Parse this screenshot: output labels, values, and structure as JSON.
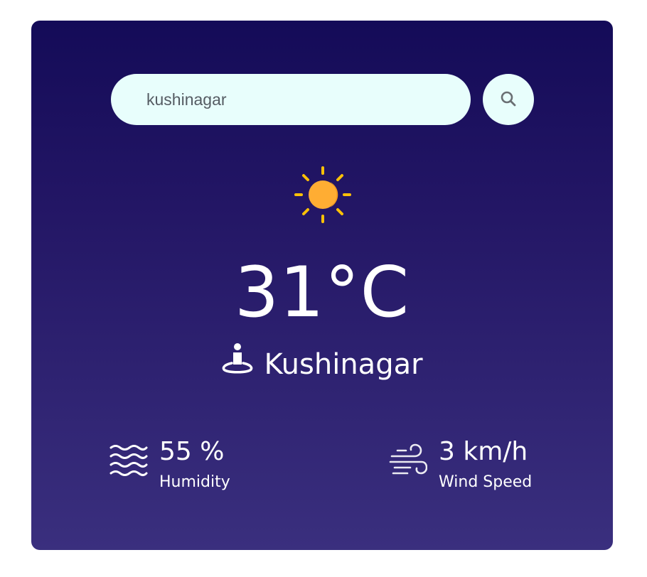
{
  "search": {
    "value": "kushinagar",
    "button_icon": "search-icon"
  },
  "weather": {
    "condition_icon": "sun-icon",
    "temperature": "31°C",
    "city": "Kushinagar",
    "location_icon": "location-pin-person-icon"
  },
  "humidity": {
    "icon": "humidity-waves-icon",
    "value": "55 %",
    "label": "Humidity"
  },
  "wind": {
    "icon": "wind-icon",
    "value": "3 km/h",
    "label": "Wind Speed"
  },
  "colors": {
    "card_top": "#140b58",
    "card_bottom": "#3a2f7e",
    "search_bg": "#e8fefc",
    "sun": "#ffad33",
    "sun_rays": "#ffc107",
    "text": "#ffffff"
  }
}
